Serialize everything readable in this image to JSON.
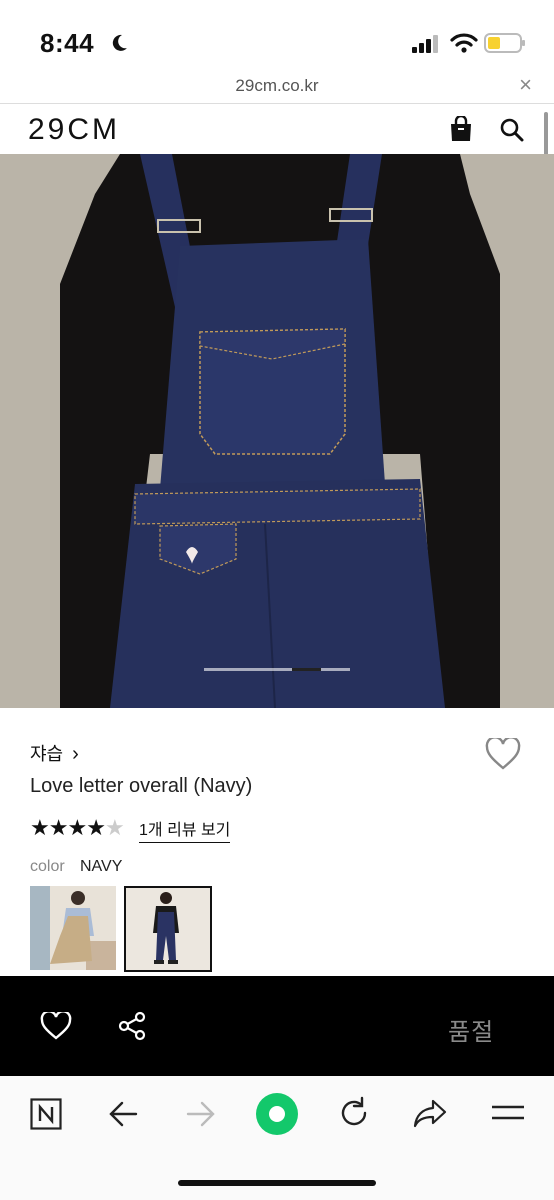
{
  "status": {
    "time": "8:44"
  },
  "browser": {
    "url": "29cm.co.kr",
    "close_label": "×"
  },
  "header": {
    "logo": "29CM"
  },
  "hero": {
    "carousel_pages": 3,
    "active_page": 2
  },
  "product": {
    "brand": "쟈습",
    "brand_chevron": "›",
    "title": "Love letter overall (Navy)",
    "rating": 4,
    "rating_max": 5,
    "review_link": "1개 리뷰 보기",
    "color_label": "color",
    "color_value": "NAVY"
  },
  "actions": {
    "soldout_label": "품절"
  },
  "colors": {
    "accent_green": "#13c86b",
    "bar_black": "#000000",
    "battery_yellow": "#f7d130"
  }
}
